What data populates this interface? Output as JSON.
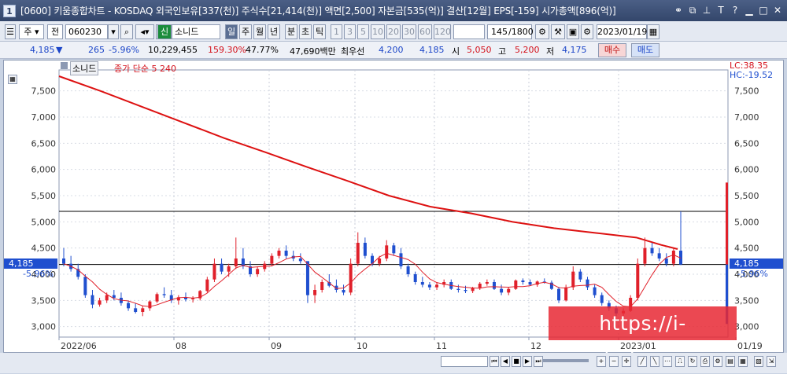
{
  "window": {
    "number": "1",
    "title": "[0600] 키움종합차트 - KOSDAQ 외국인보유[337(천)] 주식수[21,414(천)] 액면[2,500] 자본금[535(억)] 결산[12월] EPS[-159] 시가총액[896(억)]"
  },
  "toolbar": {
    "market": "주",
    "symbol_type": "전",
    "code": "060230",
    "badge": "신",
    "name": "소니드",
    "periods": [
      "일",
      "주",
      "월",
      "년",
      "분",
      "초",
      "틱"
    ],
    "intervals": [
      "1",
      "3",
      "5",
      "10",
      "20",
      "30",
      "60",
      "120"
    ],
    "count": "145",
    "count_max": "/1800",
    "date": "2023/01/19"
  },
  "quote": {
    "price": "4,185",
    "change_arrow": "▼",
    "change": "265",
    "change_pct": "-5.96%",
    "volume": "10,229,455",
    "volume_ratio": "159.30%",
    "turnover": "47.77%",
    "amount": "47,690백만",
    "best_bid_label": "최우선",
    "best_bid": "4,200",
    "best_ask": "4,185",
    "open_label": "시",
    "open": "5,050",
    "high_label": "고",
    "high": "5,200",
    "low_label": "저",
    "low": "4,175",
    "buy_label": "매수",
    "sell_label": "매도"
  },
  "chart_legend": {
    "name": "소니드",
    "ma_label": "종가 단순 5  240"
  },
  "right_info": {
    "lc": "LC:38.35",
    "hc": "HC:-19.52"
  },
  "price_tags": {
    "left_price": "4,185",
    "left_pct": "-5.96%",
    "right_price": "4,185",
    "right_pct": "-5.96%"
  },
  "x_labels": [
    "2022/06",
    "08",
    "09",
    "10",
    "11",
    "12",
    "2023/01",
    "01/19"
  ],
  "watermark": "https://i-whale.com",
  "colors": {
    "up": "#e0202a",
    "down": "#1f4fcf",
    "ma5": "#e0202a",
    "ma240": "#dd1111",
    "price_tag": "#1f4fcf"
  },
  "chart_data": {
    "type": "candlestick",
    "y_ticks": [
      3000,
      3500,
      4000,
      4500,
      5000,
      5500,
      6000,
      6500,
      7000,
      7500
    ],
    "ylim": [
      2800,
      7900
    ],
    "support_lines": [
      4185,
      5200
    ],
    "ma240_points": [
      [
        0,
        7780
      ],
      [
        20,
        7500
      ],
      [
        40,
        7200
      ],
      [
        60,
        6900
      ],
      [
        80,
        6600
      ],
      [
        100,
        6330
      ],
      [
        120,
        6050
      ],
      [
        140,
        5780
      ],
      [
        160,
        5500
      ],
      [
        180,
        5290
      ],
      [
        200,
        5160
      ],
      [
        220,
        5000
      ],
      [
        240,
        4880
      ],
      [
        260,
        4790
      ],
      [
        280,
        4700
      ],
      [
        292,
        4560
      ],
      [
        300,
        4480
      ]
    ],
    "candles": [
      [
        4300,
        4500,
        4150,
        4200
      ],
      [
        4200,
        4350,
        4050,
        4100
      ],
      [
        4100,
        4200,
        3900,
        3950
      ],
      [
        3950,
        4000,
        3550,
        3600
      ],
      [
        3600,
        3700,
        3350,
        3420
      ],
      [
        3420,
        3550,
        3380,
        3500
      ],
      [
        3500,
        3650,
        3450,
        3600
      ],
      [
        3600,
        3700,
        3500,
        3550
      ],
      [
        3550,
        3650,
        3400,
        3450
      ],
      [
        3450,
        3500,
        3300,
        3350
      ],
      [
        3350,
        3450,
        3250,
        3280
      ],
      [
        3280,
        3400,
        3200,
        3350
      ],
      [
        3350,
        3500,
        3300,
        3480
      ],
      [
        3480,
        3650,
        3450,
        3620
      ],
      [
        3620,
        3750,
        3550,
        3600
      ],
      [
        3600,
        3700,
        3450,
        3500
      ],
      [
        3500,
        3600,
        3420,
        3560
      ],
      [
        3560,
        3650,
        3480,
        3520
      ],
      [
        3520,
        3580,
        3460,
        3540
      ],
      [
        3540,
        3700,
        3500,
        3680
      ],
      [
        3680,
        3950,
        3650,
        3900
      ],
      [
        3900,
        4300,
        3850,
        4200
      ],
      [
        4200,
        4300,
        4000,
        4050
      ],
      [
        4050,
        4200,
        3950,
        4150
      ],
      [
        4150,
        4700,
        4100,
        4300
      ],
      [
        4300,
        4500,
        4100,
        4150
      ],
      [
        4150,
        4250,
        3950,
        4000
      ],
      [
        4000,
        4150,
        3950,
        4100
      ],
      [
        4100,
        4250,
        4050,
        4200
      ],
      [
        4200,
        4400,
        4150,
        4350
      ],
      [
        4350,
        4500,
        4300,
        4450
      ],
      [
        4450,
        4550,
        4300,
        4350
      ],
      [
        4350,
        4450,
        4250,
        4300
      ],
      [
        4300,
        4400,
        4200,
        4250
      ],
      [
        4250,
        3900,
        3450,
        3600
      ],
      [
        3600,
        3800,
        3450,
        3700
      ],
      [
        3700,
        3900,
        3650,
        3850
      ],
      [
        3850,
        4000,
        3750,
        3780
      ],
      [
        3780,
        3900,
        3650,
        3700
      ],
      [
        3700,
        3800,
        3600,
        3650
      ],
      [
        3650,
        4300,
        3600,
        4200
      ],
      [
        4200,
        4800,
        4150,
        4600
      ],
      [
        4600,
        4700,
        4300,
        4350
      ],
      [
        4350,
        4400,
        4150,
        4200
      ],
      [
        4200,
        4350,
        4150,
        4300
      ],
      [
        4300,
        4650,
        4250,
        4550
      ],
      [
        4550,
        4600,
        4350,
        4400
      ],
      [
        4400,
        4500,
        4100,
        4150
      ],
      [
        4150,
        4200,
        3950,
        4000
      ],
      [
        4000,
        4050,
        3800,
        3850
      ],
      [
        3850,
        3950,
        3750,
        3800
      ],
      [
        3800,
        3850,
        3700,
        3750
      ],
      [
        3750,
        3850,
        3700,
        3800
      ],
      [
        3800,
        3900,
        3750,
        3850
      ],
      [
        3850,
        3900,
        3700,
        3720
      ],
      [
        3720,
        3800,
        3650,
        3700
      ],
      [
        3700,
        3780,
        3640,
        3680
      ],
      [
        3680,
        3760,
        3640,
        3740
      ],
      [
        3740,
        3850,
        3700,
        3820
      ],
      [
        3820,
        3900,
        3780,
        3850
      ],
      [
        3850,
        3900,
        3700,
        3720
      ],
      [
        3720,
        3800,
        3600,
        3650
      ],
      [
        3650,
        3750,
        3600,
        3720
      ],
      [
        3720,
        3900,
        3700,
        3880
      ],
      [
        3880,
        3920,
        3800,
        3850
      ],
      [
        3850,
        3900,
        3780,
        3800
      ],
      [
        3800,
        3880,
        3760,
        3860
      ],
      [
        3860,
        3920,
        3820,
        3840
      ],
      [
        3840,
        3880,
        3700,
        3720
      ],
      [
        3720,
        3760,
        3450,
        3500
      ],
      [
        3500,
        3800,
        3480,
        3750
      ],
      [
        3750,
        4150,
        3700,
        4050
      ],
      [
        4050,
        4100,
        3850,
        3900
      ],
      [
        3900,
        3950,
        3700,
        3750
      ],
      [
        3750,
        3800,
        3550,
        3600
      ],
      [
        3600,
        3650,
        3400,
        3450
      ],
      [
        3450,
        3500,
        3300,
        3350
      ],
      [
        3350,
        3400,
        3200,
        3250
      ],
      [
        3250,
        3350,
        3150,
        3300
      ],
      [
        3300,
        3600,
        3280,
        3550
      ],
      [
        3550,
        4300,
        3500,
        4200
      ],
      [
        4200,
        4700,
        4150,
        4500
      ],
      [
        4500,
        4600,
        4350,
        4400
      ],
      [
        4400,
        4500,
        4250,
        4300
      ],
      [
        4300,
        4400,
        4150,
        4200
      ],
      [
        4200,
        4500,
        4150,
        4450
      ],
      [
        4450,
        5200,
        4175,
        4185
      ]
    ]
  }
}
